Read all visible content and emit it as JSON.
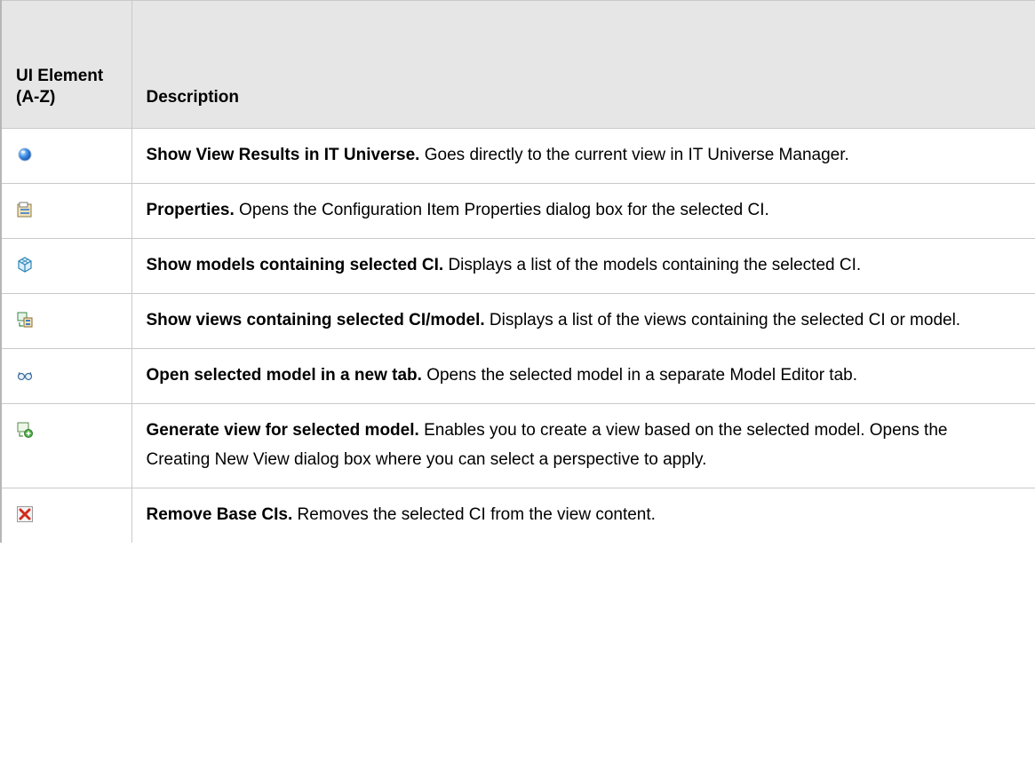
{
  "header": {
    "col_element": "UI Element (A-Z)",
    "col_description": "Description"
  },
  "rows": [
    {
      "icon": "globe-icon",
      "name": "Show View Results in IT Universe.",
      "text": " Goes directly to the current view in IT Universe Manager."
    },
    {
      "icon": "properties-icon",
      "name": "Properties.",
      "text": " Opens the Configuration Item Properties dialog box for the selected CI."
    },
    {
      "icon": "model-cube-icon",
      "name": "Show models containing selected CI.",
      "text": " Displays a list of the models containing the selected CI."
    },
    {
      "icon": "views-containing-icon",
      "name": "Show views containing selected CI/model.",
      "text": " Displays a list of the views containing the selected CI or model."
    },
    {
      "icon": "glasses-icon",
      "name": "Open selected model in a new tab.",
      "text": " Opens the selected model in a separate Model Editor tab."
    },
    {
      "icon": "generate-view-icon",
      "name": "Generate view for selected model.",
      "text": " Enables you to create a view based on the selected model. Opens the Creating New View dialog box where you can select a perspective to apply."
    },
    {
      "icon": "remove-x-icon",
      "name": "Remove Base CIs.",
      "text": " Removes the selected CI from the view content."
    }
  ],
  "colors": {
    "header_bg": "#e6e6e6",
    "border": "#c9c9c9",
    "remove_red": "#d32b1e",
    "globe_blue": "#2f7fd8"
  }
}
